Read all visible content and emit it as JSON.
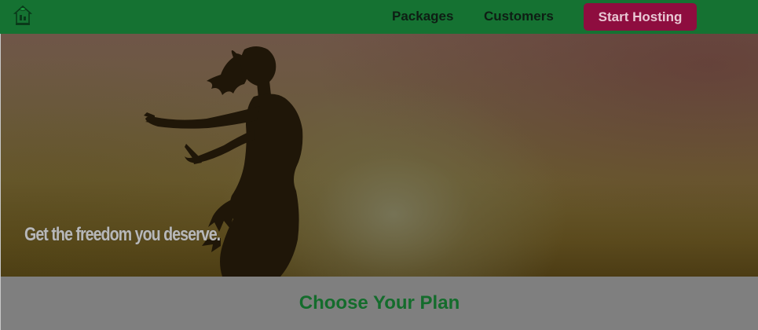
{
  "navbar": {
    "logo_icon": "house-leaf-logo-icon",
    "links": [
      {
        "label": "Packages"
      },
      {
        "label": "Customers"
      }
    ],
    "cta_label": "Start Hosting"
  },
  "hero": {
    "tagline": "Get the freedom you deserve.",
    "image": "silhouette-of-woman-at-sunset"
  },
  "plans": {
    "title": "Choose Your Plan"
  },
  "colors": {
    "navbar": "#157232",
    "cta": "#8e0d3f",
    "plan_title": "#146c2c",
    "overlay": "#7f7f7f"
  }
}
